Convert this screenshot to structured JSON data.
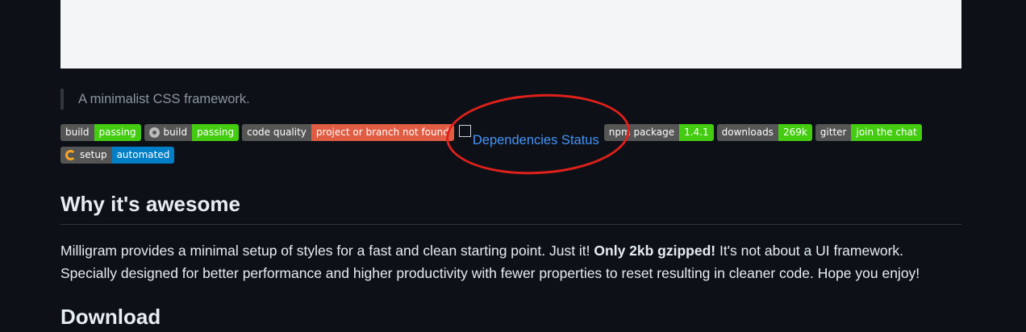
{
  "tagline": "A minimalist CSS framework.",
  "badges_row1": [
    {
      "label": "build",
      "value": "passing",
      "color": "#44cc11",
      "icon": ""
    },
    {
      "label": "build",
      "value": "passing",
      "color": "#44cc11",
      "icon": "circleci-icon"
    },
    {
      "label": "code quality",
      "value": "project or branch not found",
      "color": "#e05d44",
      "icon": ""
    }
  ],
  "dependencies_link": "Dependencies Status",
  "badges_row1b": [
    {
      "label": "npm package",
      "value": "1.4.1",
      "color": "#44cc11"
    },
    {
      "label": "downloads",
      "value": "269k",
      "color": "#44cc11"
    },
    {
      "label": "gitter",
      "value": "join the chat",
      "color": "#44cc11"
    }
  ],
  "badges_row2": [
    {
      "label": "setup",
      "value": "automated",
      "color": "#007ec6",
      "icon": "gitpod-icon"
    }
  ],
  "section_why": {
    "heading": "Why it's awesome",
    "text_1": "Milligram provides a minimal setup of styles for a fast and clean starting point. Just it! ",
    "bold": "Only 2kb gzipped!",
    "text_2": " It's not about a UI framework. Specially designed for better performance and higher productivity with fewer properties to reset resulting in cleaner code. Hope you enjoy!"
  },
  "section_download": {
    "heading": "Download"
  },
  "annotation_color": "#e0201a"
}
